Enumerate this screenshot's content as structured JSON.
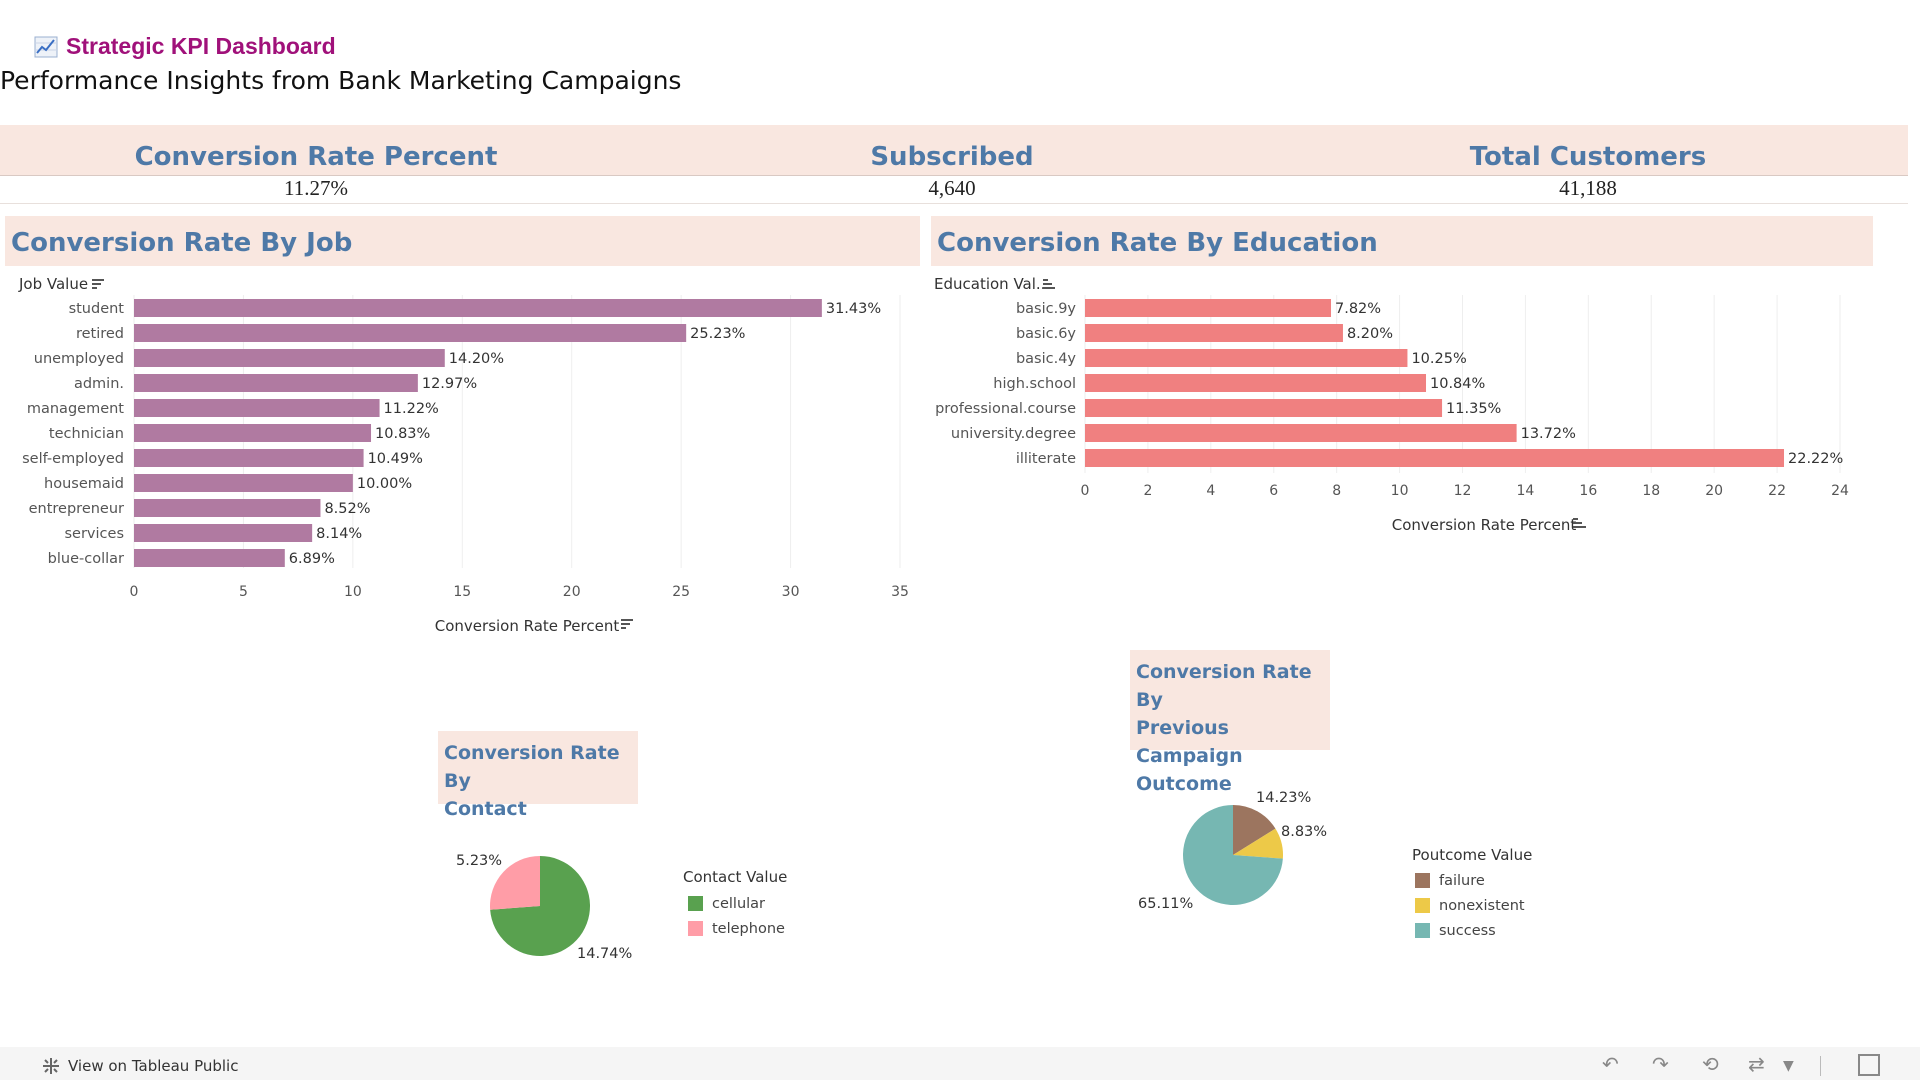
{
  "header": {
    "title": "Strategic KPI Dashboard",
    "subtitle": "Performance Insights from Bank Marketing Campaigns"
  },
  "kpis": [
    {
      "label": "Conversion Rate Percent",
      "value": "11.27%"
    },
    {
      "label": "Subscribed",
      "value": "4,640"
    },
    {
      "label": "Total Customers",
      "value": "41,188"
    }
  ],
  "job_chart": {
    "header": "Conversion Rate By Job",
    "dim_label": "Job Value",
    "axis_label": "Conversion Rate Percent",
    "bar_color": "#b07aa1",
    "ticks": [
      0,
      5,
      10,
      15,
      20,
      25,
      30,
      35
    ]
  },
  "edu_chart": {
    "header": "Conversion Rate By Education",
    "dim_label": "Education Val..",
    "axis_label": "Conversion Rate Percent",
    "bar_color": "#f08080",
    "ticks": [
      0,
      2,
      4,
      6,
      8,
      10,
      12,
      14,
      16,
      18,
      20,
      22,
      24
    ]
  },
  "contact_pie": {
    "title_line1": "Conversion Rate By",
    "title_line2": "Contact",
    "legend_title": "Contact Value",
    "legend": [
      {
        "label": "cellular",
        "color": "#59a14f"
      },
      {
        "label": "telephone",
        "color": "#ff9da7"
      }
    ]
  },
  "poutcome_pie": {
    "title_line1": "Conversion Rate By",
    "title_line2": "Previous Campaign",
    "title_line3": "Outcome",
    "legend_title": "Poutcome Value",
    "legend": [
      {
        "label": "failure",
        "color": "#9c755f"
      },
      {
        "label": "nonexistent",
        "color": "#edc948"
      },
      {
        "label": "success",
        "color": "#76b7b2"
      }
    ]
  },
  "footer": {
    "link": "View on Tableau Public"
  },
  "chart_data": [
    {
      "type": "bar",
      "title": "Conversion Rate By Job",
      "xlabel": "Conversion Rate Percent",
      "ylabel": "Job Value",
      "xlim": [
        0,
        35
      ],
      "categories": [
        "student",
        "retired",
        "unemployed",
        "admin.",
        "management",
        "technician",
        "self-employed",
        "housemaid",
        "entrepreneur",
        "services",
        "blue-collar"
      ],
      "values": [
        31.43,
        25.23,
        14.2,
        12.97,
        11.22,
        10.83,
        10.49,
        10.0,
        8.52,
        8.14,
        6.89
      ],
      "labels": [
        "31.43%",
        "25.23%",
        "14.20%",
        "12.97%",
        "11.22%",
        "10.83%",
        "10.49%",
        "10.00%",
        "8.52%",
        "8.14%",
        "6.89%"
      ]
    },
    {
      "type": "bar",
      "title": "Conversion Rate By Education",
      "xlabel": "Conversion Rate Percent",
      "ylabel": "Education Val..",
      "xlim": [
        0,
        24
      ],
      "categories": [
        "basic.9y",
        "basic.6y",
        "basic.4y",
        "high.school",
        "professional.course",
        "university.degree",
        "illiterate"
      ],
      "values": [
        7.82,
        8.2,
        10.25,
        10.84,
        11.35,
        13.72,
        22.22
      ],
      "labels": [
        "7.82%",
        "8.20%",
        "10.25%",
        "10.84%",
        "11.35%",
        "13.72%",
        "22.22%"
      ]
    },
    {
      "type": "pie",
      "title": "Conversion Rate By Contact",
      "categories": [
        "cellular",
        "telephone"
      ],
      "values": [
        14.74,
        5.23
      ],
      "labels": [
        "14.74%",
        "5.23%"
      ]
    },
    {
      "type": "pie",
      "title": "Conversion Rate By Previous Campaign Outcome",
      "categories": [
        "failure",
        "nonexistent",
        "success"
      ],
      "values": [
        14.23,
        8.83,
        65.11
      ],
      "labels": [
        "14.23%",
        "8.83%",
        "65.11%"
      ]
    }
  ]
}
